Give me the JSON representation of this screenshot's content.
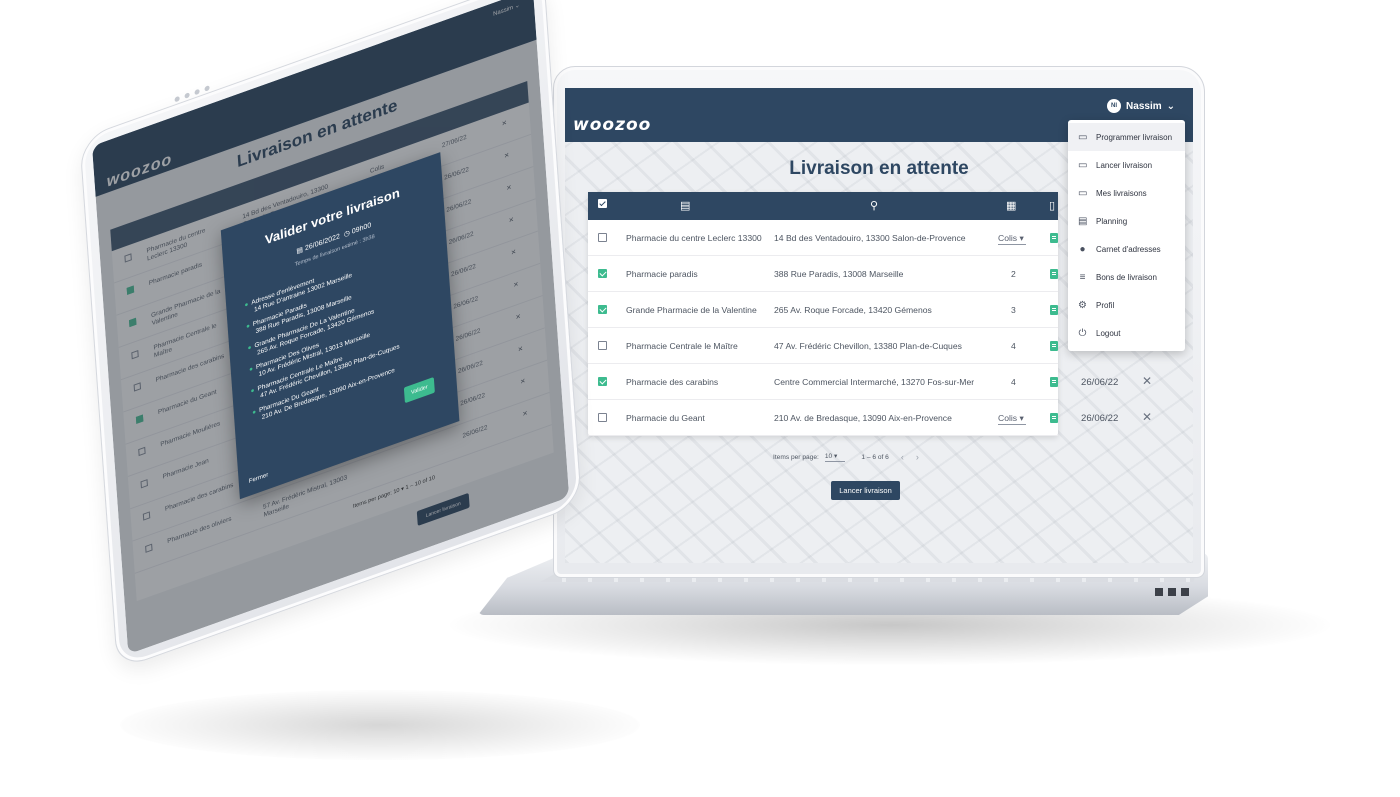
{
  "app": {
    "logo": "woozoo",
    "user_name": "Nassim",
    "user_initials": "NI",
    "page_title": "Livraison en attente"
  },
  "user_menu": [
    {
      "label": "Programmer livraison",
      "icon": "clipboard-icon"
    },
    {
      "label": "Lancer livraison",
      "icon": "clipboard-clock-icon"
    },
    {
      "label": "Mes livraisons",
      "icon": "clipboard-search-icon"
    },
    {
      "label": "Planning",
      "icon": "calendar-icon"
    },
    {
      "label": "Carnet d'adresses",
      "icon": "map-pin-icon"
    },
    {
      "label": "Bons de livraison",
      "icon": "document-list-icon"
    },
    {
      "label": "Profil",
      "icon": "user-settings-icon"
    },
    {
      "label": "Logout",
      "icon": "power-icon"
    }
  ],
  "table": {
    "header_icons": [
      "checkbox-icon",
      "calendar-icon",
      "map-pin-icon",
      "grid-icon",
      "document-icon"
    ],
    "rows": [
      {
        "checked": false,
        "name": "Pharmacie du centre Leclerc 13300",
        "address": "14 Bd des Ventadouiro, 13300 Salon-de-Provence",
        "qty": "Colis",
        "date": ""
      },
      {
        "checked": true,
        "name": "Pharmacie paradis",
        "address": "388 Rue Paradis, 13008 Marseille",
        "qty": "2",
        "date": ""
      },
      {
        "checked": true,
        "name": "Grande Pharmacie de la Valentine",
        "address": "265 Av. Roque Forcade, 13420 Gémenos",
        "qty": "3",
        "date": ""
      },
      {
        "checked": false,
        "name": "Pharmacie Centrale le Maître",
        "address": "47 Av. Frédéric Chevillon, 13380 Plan-de-Cuques",
        "qty": "4",
        "date": ""
      },
      {
        "checked": true,
        "name": "Pharmacie des carabins",
        "address": "Centre Commercial Intermarché, 13270 Fos-sur-Mer",
        "qty": "4",
        "date": "26/06/22"
      },
      {
        "checked": false,
        "name": "Pharmacie du Geant",
        "address": "210 Av. de Bredasque, 13090 Aix-en-Provence",
        "qty": "Colis",
        "date": "26/06/22"
      }
    ]
  },
  "pagination": {
    "items_per_page_label": "Items per page:",
    "items_per_page_value": "10",
    "range": "1 – 6 of 6"
  },
  "launch_button": "Lancer livraison",
  "tablet": {
    "logo": "woozoo",
    "user_name": "Nassim",
    "page_title": "Livraison en attente",
    "visible_dates": [
      "27/06/22",
      "26/06/22",
      "26/06/22",
      "26/06/22",
      "26/06/22",
      "26/06/22",
      "26/06/22",
      "26/06/22",
      "26/06/22",
      "26/06/22"
    ],
    "rows": [
      {
        "checked": false,
        "name": "Pharmacie du centre Leclerc 13300",
        "address": "14 Bd des Ventadouiro, 13300 Salon-de-Provence",
        "qty": "Colis"
      },
      {
        "checked": true,
        "name": "Pharmacie paradis",
        "address": "",
        "qty": ""
      },
      {
        "checked": true,
        "name": "Grande Pharmacie de la Valentine",
        "address": "",
        "qty": ""
      },
      {
        "checked": false,
        "name": "Pharmacie Centrale le Maître",
        "address": "",
        "qty": ""
      },
      {
        "checked": false,
        "name": "Pharmacie des carabins",
        "address": "",
        "qty": ""
      },
      {
        "checked": true,
        "name": "Pharmacie du Geant",
        "address": "",
        "qty": ""
      },
      {
        "checked": false,
        "name": "Pharmacie Mouliéres",
        "address": "",
        "qty": ""
      },
      {
        "checked": false,
        "name": "Pharmacie Jean",
        "address": "",
        "qty": ""
      },
      {
        "checked": false,
        "name": "Pharmacie des carabins",
        "address": "Fos-sur-Mer",
        "qty": "4"
      },
      {
        "checked": false,
        "name": "Pharmacie des oliviers",
        "address": "57 Av. Frédéric Mistral, 13003 Marseille",
        "qty": ""
      }
    ],
    "pager_label": "Items per page:",
    "pager_value": "10",
    "pager_range": "1 – 10 of 10",
    "launch_button": "Lancer livraison",
    "dialog": {
      "title": "Valider votre livraison",
      "date": "26/06/2022",
      "time": "09h00",
      "estimate": "Temps de livraison estimé : 3h38",
      "stops": [
        {
          "title": "Adresse d'enlèvement",
          "address": "14 Rue D'antraine 13002 Marseille"
        },
        {
          "title": "Pharmacie Paradis",
          "address": "388 Rue Paradis, 13008 Marseille"
        },
        {
          "title": "Grande Pharmacie De La Valentine",
          "address": "265 Av. Roque Forcade, 13420 Gémenos"
        },
        {
          "title": "Pharmacie Des Olives",
          "address": "10 Av. Frédéric Mistral, 13013 Marseille"
        },
        {
          "title": "Pharmacie Centrale Le Maître",
          "address": "47 Av. Frédéric Chevillon, 13380 Plan-de-Cuques"
        },
        {
          "title": "Pharmacie Du Geant",
          "address": "210 Av. De Bredasque, 13090 Aix-en-Provence"
        }
      ],
      "validate": "Valider",
      "close": "Fermer"
    }
  },
  "colors": {
    "primary": "#2e4762",
    "accent": "#3dbb8f",
    "background": "#edeff2"
  }
}
